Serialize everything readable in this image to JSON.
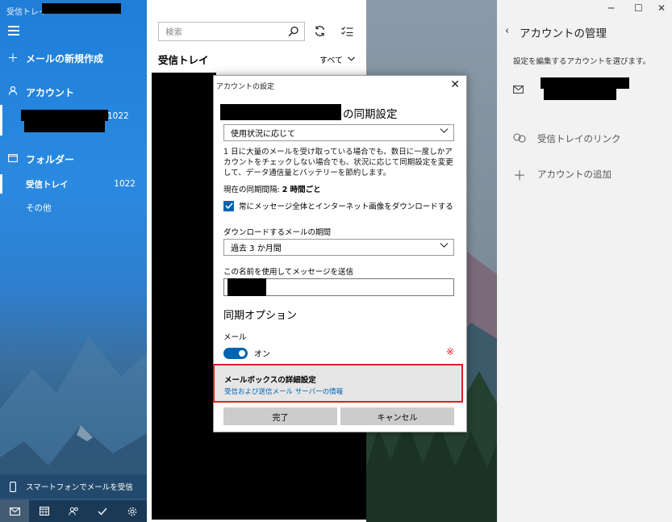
{
  "window": {
    "title": "受信トレイ -"
  },
  "sidebar": {
    "new_mail": "メールの新規作成",
    "accounts_heading": "アカウント",
    "account_count": "1022",
    "folders_heading": "フォルダー",
    "folders": [
      {
        "label": "受信トレイ",
        "count": "1022"
      },
      {
        "label": "その他",
        "count": ""
      }
    ],
    "phone_promo": "スマートフォンでメールを受信"
  },
  "list": {
    "search_placeholder": "検索",
    "title": "受信トレイ",
    "filter": "すべて"
  },
  "right_panel": {
    "title": "アカウントの管理",
    "description": "設定を編集するアカウントを選びます。",
    "link_inboxes": "受信トレイのリンク",
    "add_account": "アカウントの追加"
  },
  "dialog": {
    "title": "アカウントの設定",
    "sync_heading_suffix": "の同期設定",
    "download_mode": "使用状況に応じて",
    "description": "1 日に大量のメールを受け取っている場合でも、数日に一度しかアカウントをチェックしない場合でも、状況に応じて同期設定を変更して、データ通信量とバッテリーを節約します。",
    "interval_label": "現在の同期間隔: ",
    "interval_value": "2 時間ごと",
    "always_download": "常にメッセージ全体とインターネット画像をダウンロードする",
    "download_period_label": "ダウンロードするメールの期間",
    "download_period": "過去 3 か月間",
    "send_name_label": "この名前を使用してメッセージを送信",
    "sync_options": "同期オプション",
    "mail_label": "メール",
    "mail_toggle": "オン",
    "note_mark": "※",
    "mailbox_advanced": "メールボックスの詳細設定",
    "mailbox_advanced_sub": "受信および送信メール サーバーの情報",
    "done": "完了",
    "cancel": "キャンセル"
  },
  "colors": {
    "accent": "#0063b1",
    "sidebar_blue": "#1f7ed8",
    "highlight_red": "#d9212a"
  }
}
